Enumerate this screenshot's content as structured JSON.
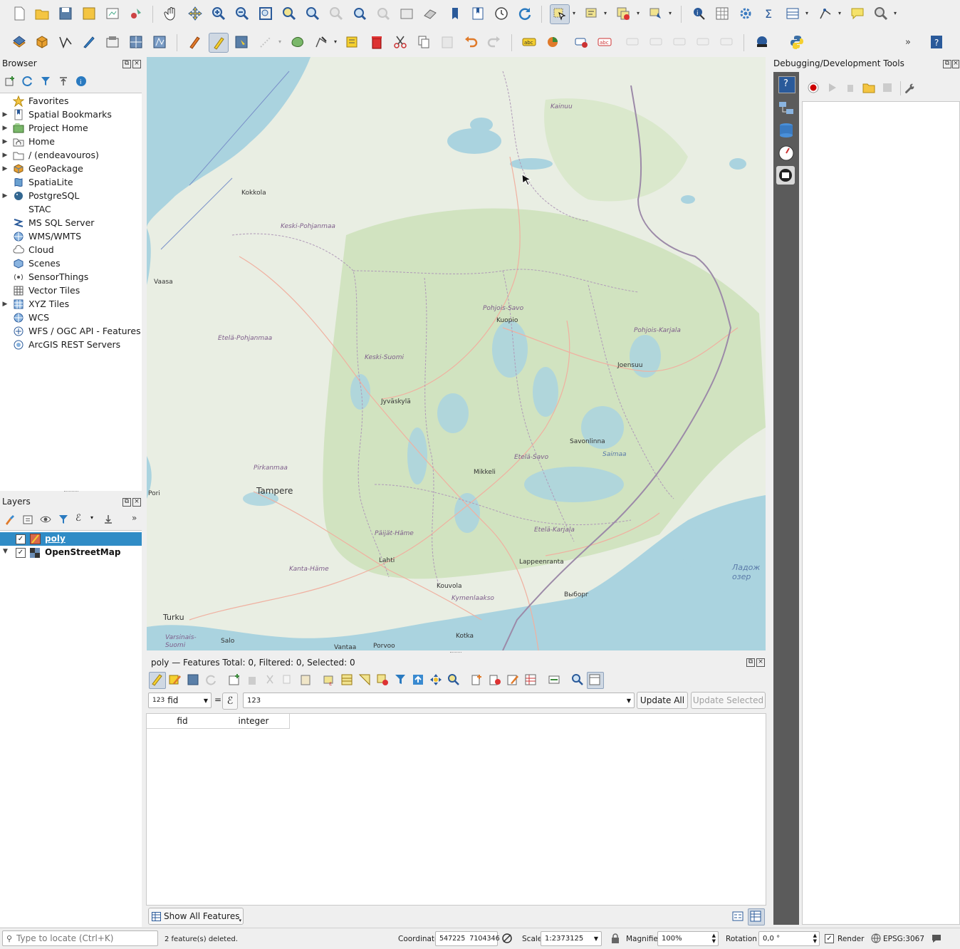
{
  "toolbar": {
    "row1_icons": [
      "new-project-icon",
      "open-project-icon",
      "save-project-icon",
      "save-as-icon",
      "print-layout-icon",
      "style-manager-icon",
      "pan-icon",
      "pan-to-selection-icon",
      "zoom-in-icon",
      "zoom-out-icon",
      "zoom-full-icon",
      "zoom-to-selection-icon",
      "zoom-to-layer-icon",
      "zoom-native-icon",
      "zoom-last-icon",
      "zoom-next-icon",
      "new-map-view-icon",
      "new-3d-map-icon",
      "new-bookmark-icon",
      "show-bookmarks-icon",
      "temporal-controller-icon",
      "refresh-icon",
      "select-features-icon",
      "select-by-expression-icon",
      "deselect-icon",
      "select-by-location-icon",
      "identify-icon",
      "attribute-table-icon",
      "settings-icon",
      "statistics-icon",
      "open-field-calculator-icon",
      "measure-icon",
      "annotation-icon",
      "locator-icon"
    ],
    "row2_icons": [
      "data-source-manager-icon",
      "new-geopackage-icon",
      "new-shapefile-icon",
      "digitize-icon",
      "new-temporary-layer-icon",
      "new-virtual-layer-icon",
      "new-mesh-icon",
      "current-edits-icon",
      "toggle-editing-icon",
      "save-edits-icon",
      "digitize-line-icon",
      "add-polygon-icon",
      "vertex-tool-icon",
      "modify-attributes-icon",
      "delete-selected-icon",
      "cut-features-icon",
      "copy-features-icon",
      "paste-features-icon",
      "undo-icon",
      "redo-icon",
      "label-tool-icon",
      "diagram-tool-icon",
      "highlight-pin-icon",
      "label-remove-icon",
      "label-pin-icon",
      "label-show-icon",
      "label-move-icon",
      "label-rotate-icon",
      "label-change-icon",
      "plugin-icon",
      "python-icon",
      "help-icon"
    ]
  },
  "browser": {
    "title": "Browser",
    "items": [
      {
        "label": "Favorites",
        "icon": "star-icon",
        "expand": false
      },
      {
        "label": "Spatial Bookmarks",
        "icon": "bookmark-icon",
        "expand": true
      },
      {
        "label": "Project Home",
        "icon": "project-home-icon",
        "expand": true
      },
      {
        "label": "Home",
        "icon": "home-folder-icon",
        "expand": true
      },
      {
        "label": "/ (endeavouros)",
        "icon": "folder-icon",
        "expand": true
      },
      {
        "label": "GeoPackage",
        "icon": "geopackage-icon",
        "expand": true
      },
      {
        "label": "SpatiaLite",
        "icon": "spatialite-icon",
        "expand": false
      },
      {
        "label": "PostgreSQL",
        "icon": "postgresql-icon",
        "expand": true
      },
      {
        "label": "STAC",
        "icon": "stac-icon",
        "expand": false
      },
      {
        "label": "MS SQL Server",
        "icon": "mssql-icon",
        "expand": false
      },
      {
        "label": "WMS/WMTS",
        "icon": "wms-icon",
        "expand": false
      },
      {
        "label": "Cloud",
        "icon": "cloud-icon",
        "expand": false
      },
      {
        "label": "Scenes",
        "icon": "scenes-icon",
        "expand": false
      },
      {
        "label": "SensorThings",
        "icon": "sensorthings-icon",
        "expand": false
      },
      {
        "label": "Vector Tiles",
        "icon": "vector-tiles-icon",
        "expand": false
      },
      {
        "label": "XYZ Tiles",
        "icon": "xyz-tiles-icon",
        "expand": true
      },
      {
        "label": "WCS",
        "icon": "wcs-icon",
        "expand": false
      },
      {
        "label": "WFS / OGC API - Features",
        "icon": "wfs-icon",
        "expand": false
      },
      {
        "label": "ArcGIS REST Servers",
        "icon": "arcgis-icon",
        "expand": false
      }
    ]
  },
  "layers": {
    "title": "Layers",
    "items": [
      {
        "label": "poly",
        "checked": true,
        "selected": true
      },
      {
        "label": "OpenStreetMap",
        "checked": true,
        "selected": false
      }
    ]
  },
  "map": {
    "labels": [
      {
        "text": "Kainuu"
      },
      {
        "text": "Kokkola"
      },
      {
        "text": "Keski-Pohjanmaa"
      },
      {
        "text": "Vaasa"
      },
      {
        "text": "Pohjois-Savo"
      },
      {
        "text": "Kuopio"
      },
      {
        "text": "Pohjois-Karjala"
      },
      {
        "text": "Joensuu"
      },
      {
        "text": "Etelä-Pohjanmaa"
      },
      {
        "text": "Keski-Suomi"
      },
      {
        "text": "Jyväskylä"
      },
      {
        "text": "Savonlinna"
      },
      {
        "text": "Etelä-Savo"
      },
      {
        "text": "Mikkeli"
      },
      {
        "text": "Pirkanmaa"
      },
      {
        "text": "Tampere"
      },
      {
        "text": "Päijät-Häme"
      },
      {
        "text": "Etelä-Karjala"
      },
      {
        "text": "Lahti"
      },
      {
        "text": "Lappeenranta"
      },
      {
        "text": "Kanta-Häme"
      },
      {
        "text": "Kouvola"
      },
      {
        "text": "Kymenlaakso"
      },
      {
        "text": "Выборг"
      },
      {
        "text": "Turku"
      },
      {
        "text": "Varsinais-Suomi"
      },
      {
        "text": "Salo"
      },
      {
        "text": "Vantaa"
      },
      {
        "text": "Porvoo"
      },
      {
        "text": "Kotka"
      },
      {
        "text": "Ладож озер"
      },
      {
        "text": "Pori"
      },
      {
        "text": "Saimaa"
      }
    ]
  },
  "debug_panel": {
    "title": "Debugging/Development Tools"
  },
  "attribute_table": {
    "title": "poly — Features Total: 0, Filtered: 0, Selected: 0",
    "field_selector": "fid",
    "field_prefix": "123",
    "equals": "=",
    "expression_value": "123",
    "update_all": "Update All",
    "update_selected": "Update Selected",
    "columns": [
      "fid",
      "integer"
    ],
    "show_all": "Show All Features"
  },
  "status_bar": {
    "locator_placeholder": "Type to locate (Ctrl+K)",
    "message": "2 feature(s) deleted.",
    "coordinate_label": "Coordinate",
    "coordinate_value": "547225  7104346",
    "scale_label": "Scale",
    "scale_value": "1:2373125",
    "magnifier_label": "Magnifier",
    "magnifier_value": "100%",
    "rotation_label": "Rotation",
    "rotation_value": "0,0 °",
    "render_label": "Render",
    "crs": "EPSG:3067"
  },
  "colors": {
    "selection": "#308cc6",
    "map_land": "#e9eee3",
    "water": "#aad3df",
    "forest": "#c8dfb4"
  }
}
